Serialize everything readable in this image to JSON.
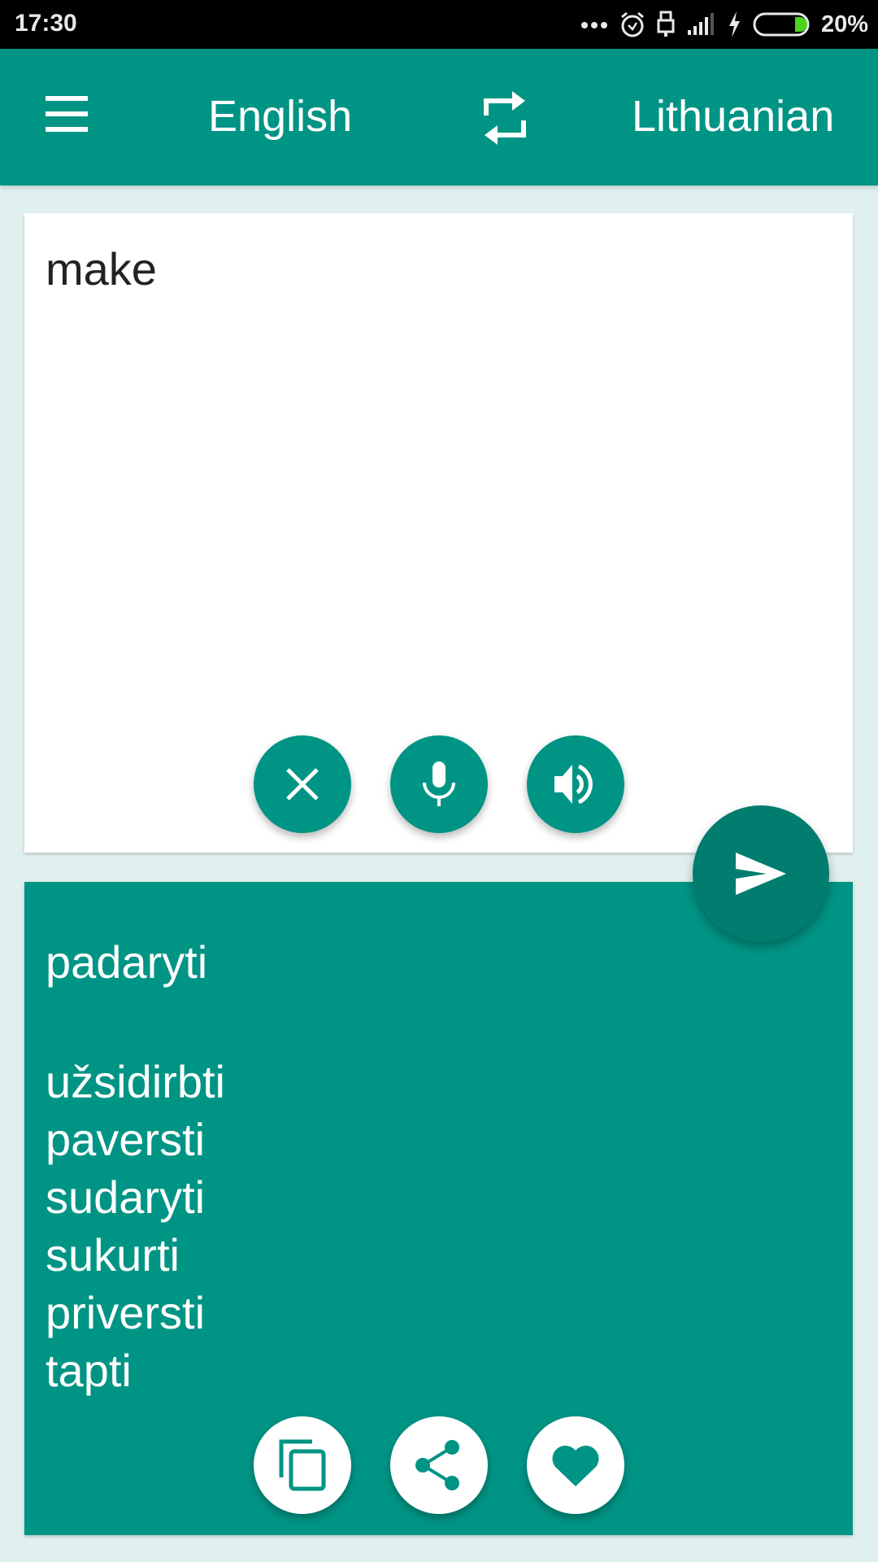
{
  "status_bar": {
    "time": "17:30",
    "battery_percent": "20%",
    "battery_level": 0.2,
    "icons": [
      "more-dots-icon",
      "alarm-icon",
      "usb-icon",
      "signal-icon",
      "charging-icon",
      "battery-icon"
    ]
  },
  "app_bar": {
    "menu_icon": "menu-icon",
    "source_language": "English",
    "swap_icon": "swap-icon",
    "target_language": "Lithuanian"
  },
  "input_card": {
    "text": "make",
    "buttons": [
      {
        "name": "clear",
        "icon": "close-icon"
      },
      {
        "name": "voice-input",
        "icon": "microphone-icon"
      },
      {
        "name": "speak",
        "icon": "speaker-icon"
      }
    ]
  },
  "translate_button": {
    "icon": "send-icon"
  },
  "output_card": {
    "primary_translation": "padaryti",
    "alternatives": [
      "užsidirbti",
      "paversti",
      "sudaryti",
      "sukurti",
      "priversti",
      "tapti"
    ],
    "buttons": [
      {
        "name": "copy",
        "icon": "copy-icon"
      },
      {
        "name": "share",
        "icon": "share-icon"
      },
      {
        "name": "favorite",
        "icon": "heart-icon"
      }
    ]
  },
  "colors": {
    "primary": "#009484",
    "primary_dark": "#007d6e",
    "background": "#dff0ee",
    "battery_green": "#4cd21c"
  }
}
